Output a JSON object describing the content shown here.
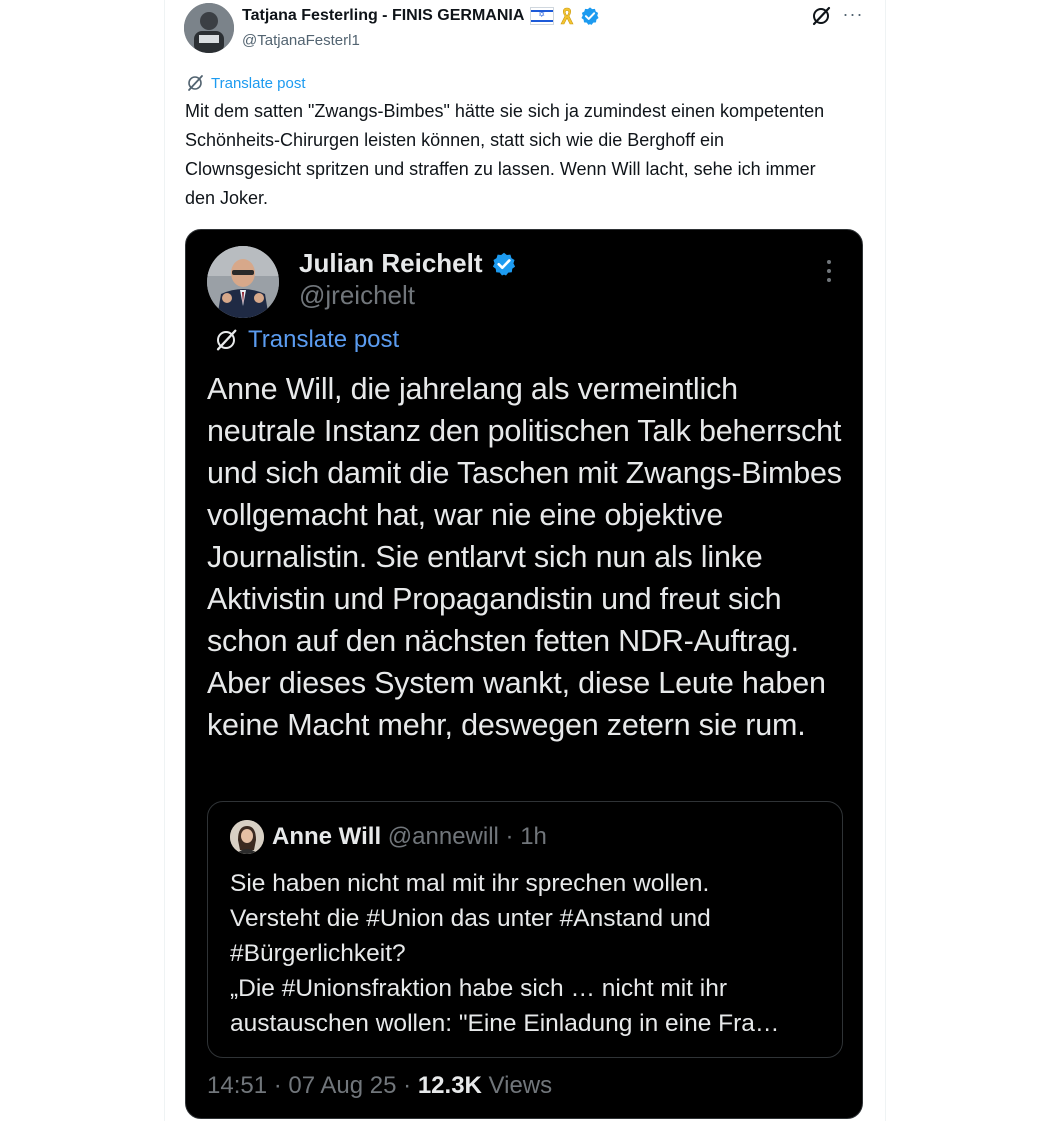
{
  "post": {
    "author_name": "Tatjana Festerling - FINIS GERMANIA",
    "author_handle": "@TatjanaFesterl1",
    "translate_label": "Translate post",
    "more_label": "···",
    "text": "Mit dem satten \"Zwangs-Bimbes\" hätte sie sich ja zumindest einen kompetenten Schönheits-Chirurgen leisten können, statt sich wie die Berghoff ein Clownsgesicht spritzen und straffen zu lassen. Wenn Will lacht, sehe ich immer den Joker."
  },
  "embedded": {
    "author_name": "Julian Reichelt",
    "author_handle": "@jreichelt",
    "translate_label": "Translate post",
    "text": "Anne Will, die jahrelang als vermeintlich neutrale Instanz den politischen Talk beherrscht und sich damit die Taschen mit Zwangs-Bimbes vollgemacht hat, war nie eine objektive Journalistin. Sie entlarvt sich nun als linke Aktivistin und Propagandistin und freut sich schon auf den nächsten fetten NDR-Auftrag. Aber dieses System wankt, diese Leute haben keine Macht mehr, deswegen zetern sie rum.",
    "quote": {
      "author_name": "Anne Will",
      "meta": "@annewill · 1h",
      "line1": "Sie haben nicht mal mit ihr sprechen wollen.",
      "line2": "Versteht die #Union das unter #Anstand und",
      "line3": "#Bürgerlichkeit?",
      "line4": "„Die #Unionsfraktion habe sich … nicht mit ihr",
      "line5": "austauschen wollen: \"Eine Einladung in eine Fra…"
    },
    "timestamp": "14:51 · 07 Aug 25 · ",
    "views_count": "12.3K",
    "views_label": " Views"
  },
  "colors": {
    "accent": "#1d9bf0",
    "text_primary": "#0f1419",
    "text_secondary": "#536471",
    "dark_bg": "#000000",
    "dark_text": "#e7e9ea"
  },
  "icons": {
    "verified": "verified-badge-icon",
    "flag": "israel-flag-icon",
    "ribbon": "yellow-ribbon-icon",
    "grok": "grok-icon",
    "more": "more-icon",
    "translate": "translate-icon"
  }
}
